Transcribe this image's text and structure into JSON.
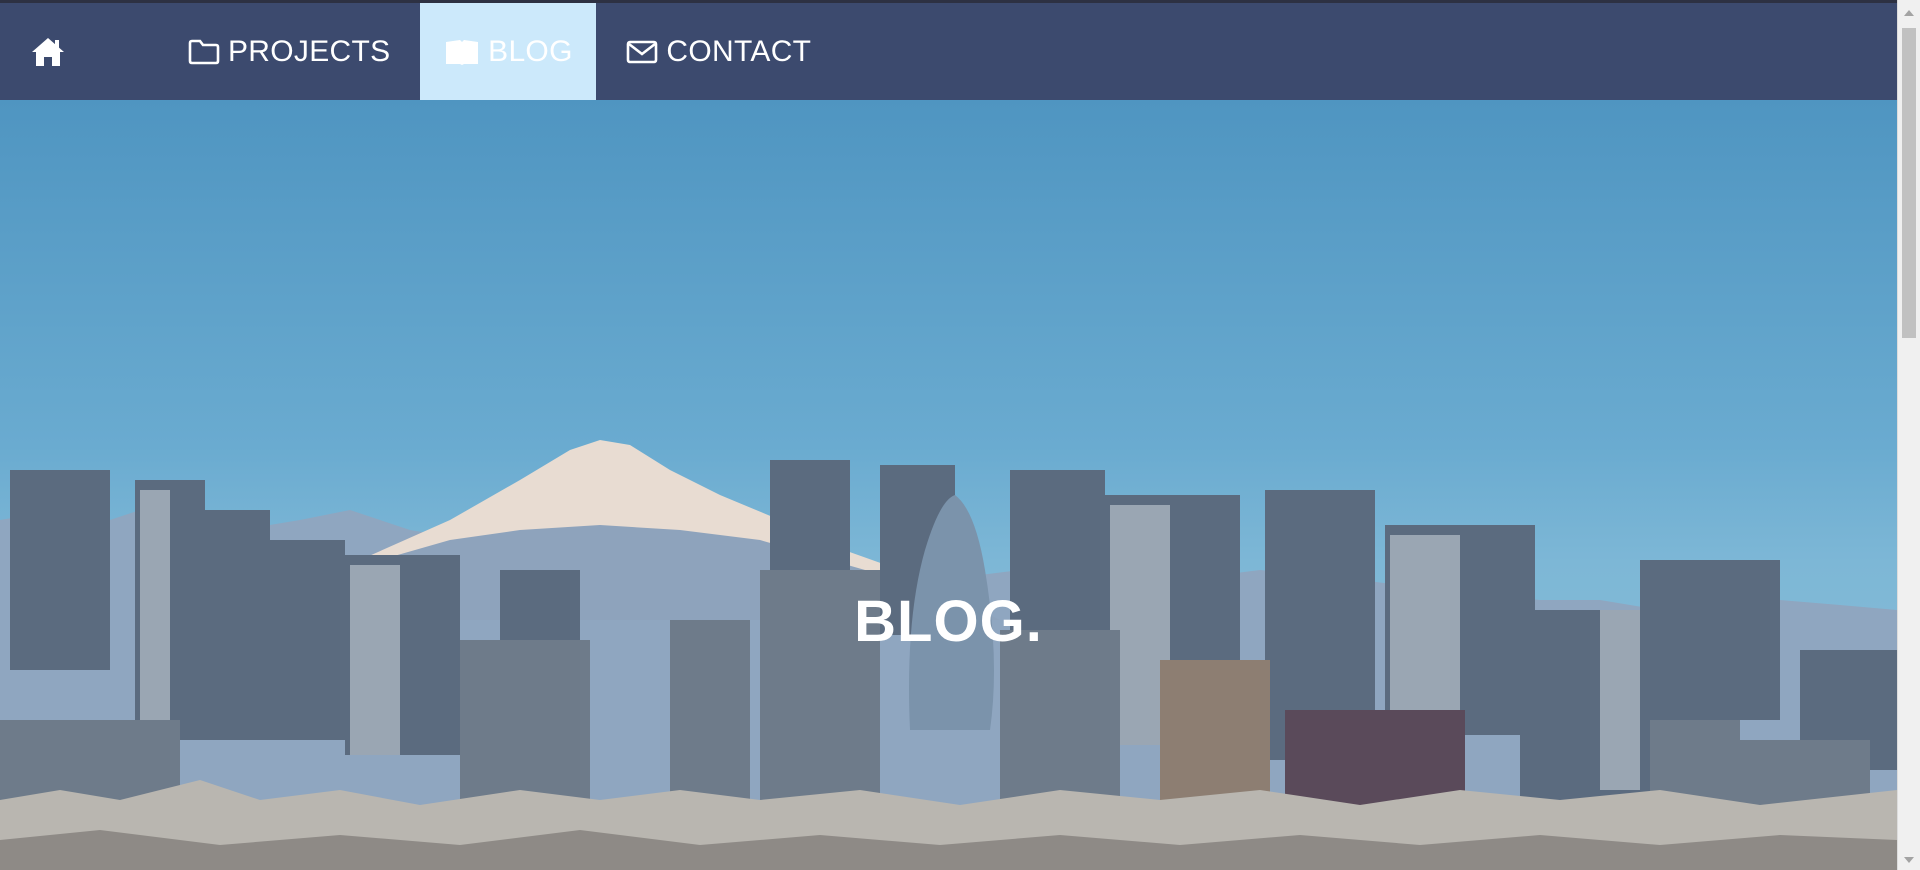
{
  "nav": {
    "home_icon": "home-icon",
    "items": [
      {
        "label": "PROJECTS",
        "icon": "folder-icon"
      },
      {
        "label": "BLOG",
        "icon": "book-icon",
        "active": true
      },
      {
        "label": "CONTACT",
        "icon": "envelope-icon"
      }
    ]
  },
  "hero": {
    "title": "BLOG.",
    "image": "tokyo-skyline-with-mount-fuji"
  },
  "colors": {
    "navbar": "#3c4a6e",
    "active_tab": "#cce9fb",
    "sky": "#5a9fc9"
  }
}
